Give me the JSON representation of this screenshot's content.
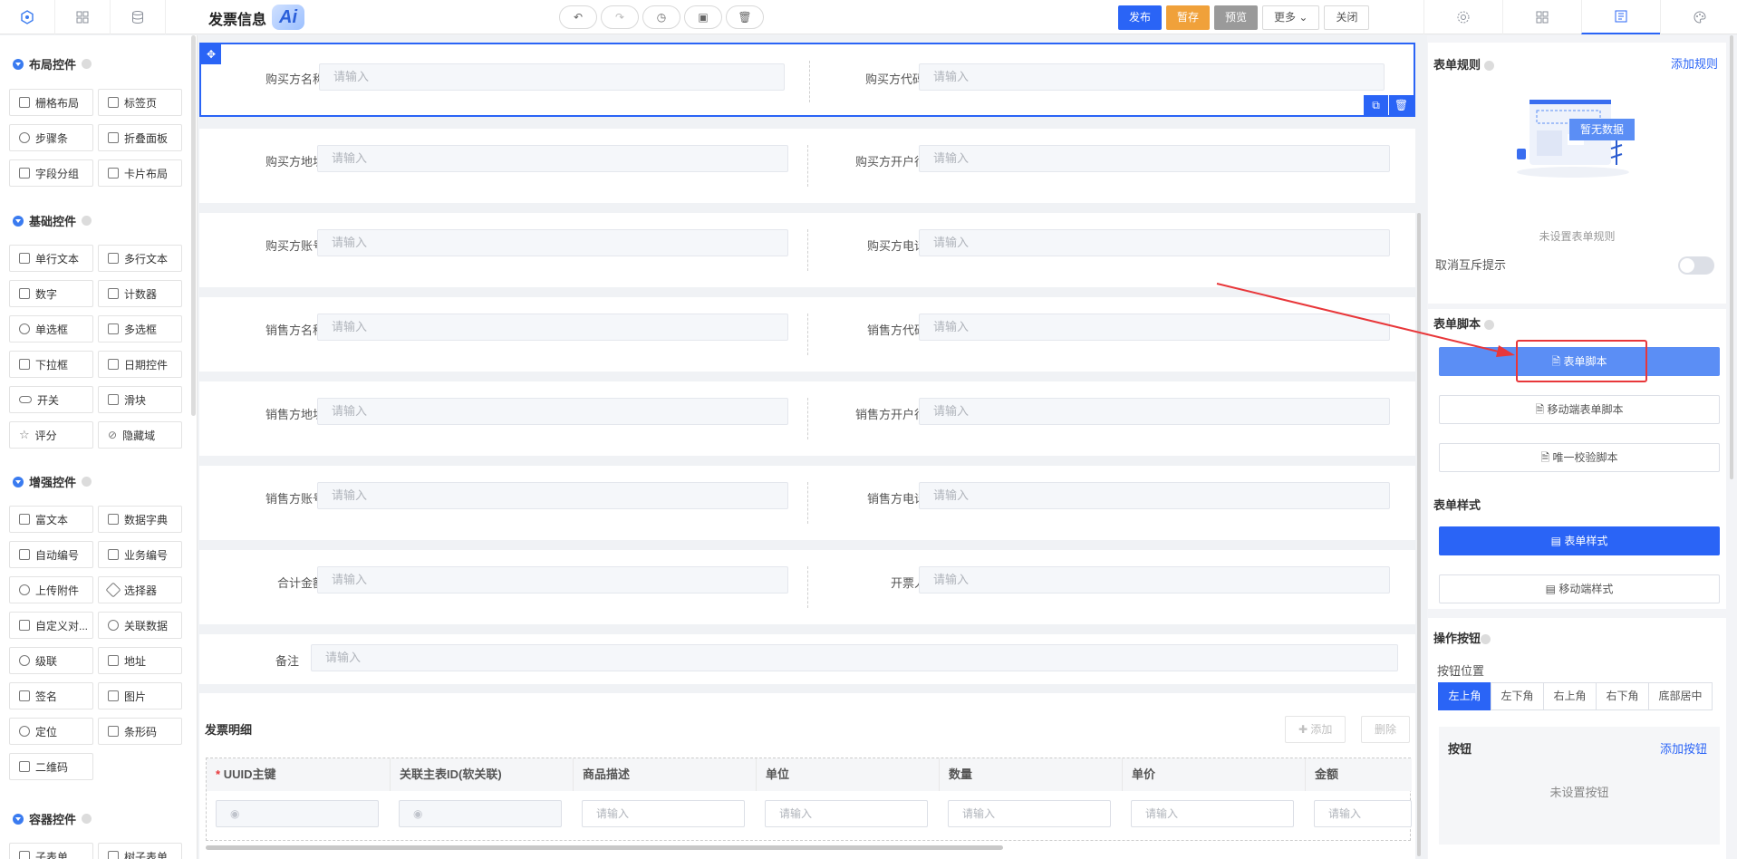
{
  "app": {
    "title": "发票信息",
    "ai_badge": "Ai"
  },
  "toolbar": {
    "publish": "发布",
    "save_draft": "暂存",
    "preview": "预览",
    "more": "更多",
    "close": "关闭"
  },
  "left_palette": {
    "groups": [
      {
        "title": "布局控件",
        "items": [
          "栅格布局",
          "标签页",
          "步骤条",
          "折叠面板",
          "字段分组",
          "卡片布局"
        ]
      },
      {
        "title": "基础控件",
        "items": [
          "单行文本",
          "多行文本",
          "数字",
          "计数器",
          "单选框",
          "多选框",
          "下拉框",
          "日期控件",
          "开关",
          "滑块",
          "评分",
          "隐藏域"
        ]
      },
      {
        "title": "增强控件",
        "items": [
          "富文本",
          "数据字典",
          "自动编号",
          "业务编号",
          "上传附件",
          "选择器",
          "自定义对...",
          "关联数据",
          "级联",
          "地址",
          "签名",
          "图片",
          "定位",
          "条形码",
          "二维码"
        ]
      },
      {
        "title": "容器控件",
        "items": [
          "子表单",
          "树子表单"
        ]
      }
    ]
  },
  "form": {
    "placeholder": "请输入",
    "fields": [
      {
        "left": "购买方名称",
        "right": "购买方代码"
      },
      {
        "left": "购买方地址",
        "right": "购买方开户行"
      },
      {
        "left": "购买方账号",
        "right": "购买方电话"
      },
      {
        "left": "销售方名称",
        "right": "销售方代码"
      },
      {
        "left": "销售方地址",
        "right": "销售方开户行"
      },
      {
        "left": "销售方账号",
        "right": "销售方电话"
      },
      {
        "left": "合计金额",
        "right": "开票人"
      }
    ],
    "remark_label": "备注"
  },
  "detail_table": {
    "title": "发票明细",
    "add": "添加",
    "delete": "删除",
    "required_mark": "*",
    "columns": [
      "UUID主键",
      "关联主表ID(软关联)",
      "商品描述",
      "单位",
      "数量",
      "单价",
      "金额"
    ],
    "cell_placeholder": "请输入"
  },
  "right_panel": {
    "form_rules": {
      "title": "表单规则",
      "add_link": "添加规则",
      "empty_badge": "暂无数据",
      "empty_text": "未设置表单规则",
      "mutex_label": "取消互斥提示"
    },
    "form_script": {
      "title": "表单脚本",
      "btn_script": "表单脚本",
      "btn_mobile_script": "移动端表单脚本",
      "btn_unique_script": "唯一校验脚本"
    },
    "form_style": {
      "title": "表单样式",
      "btn_style": "表单样式",
      "btn_mobile_style": "移动端样式"
    },
    "action_buttons": {
      "title": "操作按钮",
      "position_label": "按钮位置",
      "positions": [
        "左上角",
        "左下角",
        "右上角",
        "右下角",
        "底部居中"
      ],
      "active_position": "左上角",
      "buttons_label": "按钮",
      "add_button": "添加按钮",
      "empty_text": "未设置按钮"
    }
  },
  "colors": {
    "accent": "#2a64f6",
    "draft": "#f0a13a",
    "annotation": "#e8373a"
  }
}
